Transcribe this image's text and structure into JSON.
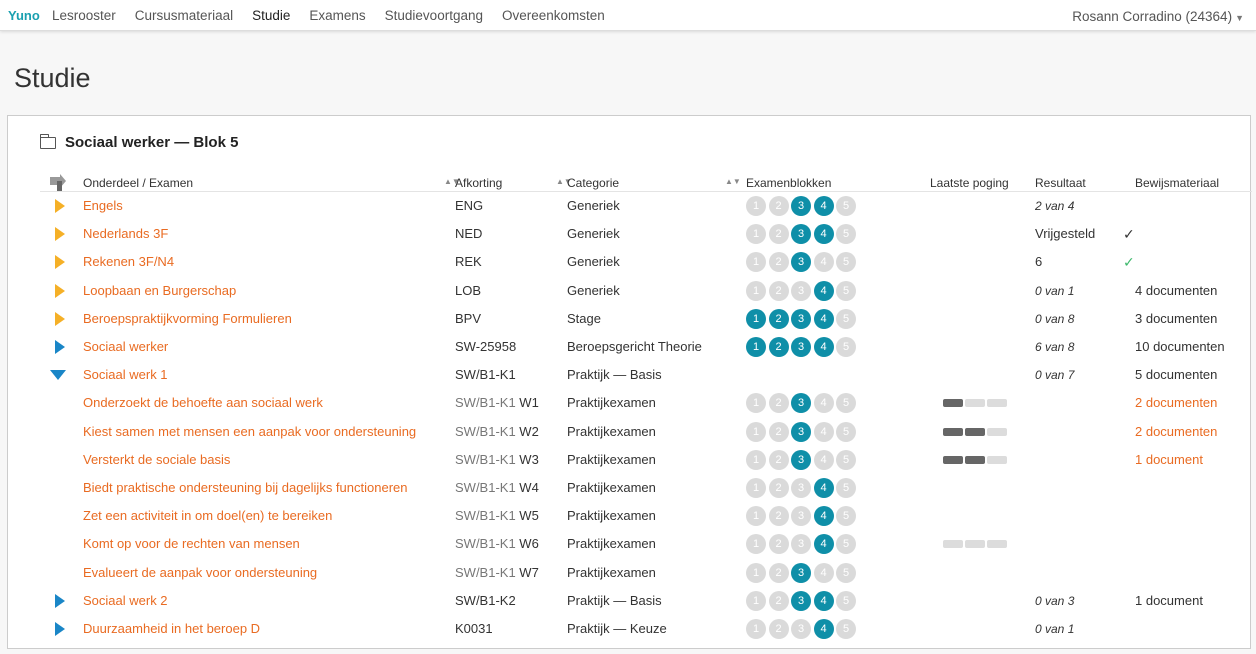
{
  "nav": {
    "brand": "Yuno",
    "items": [
      "Lesrooster",
      "Cursusmateriaal",
      "Studie",
      "Examens",
      "Studievoortgang",
      "Overeenkomsten"
    ],
    "active": "Studie",
    "user": "Rosann Corradino  (24364)"
  },
  "page": {
    "title": "Studie"
  },
  "card": {
    "title": "Sociaal werker — Blok 5"
  },
  "columns": {
    "name": "Onderdeel / Examen",
    "abbr": "Afkorting",
    "category": "Categorie",
    "blocks": "Examenblokken",
    "last_attempt": "Laatste poging",
    "result": "Resultaat",
    "evidence": "Bewijsmateriaal"
  },
  "rows": [
    {
      "name": "Engels",
      "abbr": "ENG",
      "category": "Generiek",
      "blocks": [
        3,
        4
      ],
      "result": "2 van 4",
      "result_italic": true,
      "evidence": "",
      "check": "",
      "toggle": "right-y"
    },
    {
      "name": "Nederlands 3F",
      "abbr": "NED",
      "category": "Generiek",
      "blocks": [
        3,
        4
      ],
      "result": "Vrijgesteld",
      "result_italic": false,
      "evidence": "",
      "check": "✓",
      "toggle": "right-y"
    },
    {
      "name": "Rekenen 3F/N4",
      "abbr": "REK",
      "category": "Generiek",
      "blocks": [
        3
      ],
      "result": "6",
      "result_italic": false,
      "evidence": "",
      "check": "✓",
      "check_green": true,
      "toggle": "right-y"
    },
    {
      "name": "Loopbaan en Burgerschap",
      "abbr": "LOB",
      "category": "Generiek",
      "blocks": [
        4
      ],
      "result": "0 van 1",
      "result_italic": true,
      "evidence": "4 documenten",
      "toggle": "right-y"
    },
    {
      "name": "Beroepspraktijkvorming Formulieren",
      "abbr": "BPV",
      "category": "Stage",
      "blocks": [
        1,
        2,
        3,
        4
      ],
      "result": "0 van 8",
      "result_italic": true,
      "evidence": "3 documenten",
      "toggle": "right-y"
    },
    {
      "name": "Sociaal werker",
      "abbr": "SW-25958",
      "category": "Beroepsgericht Theorie",
      "blocks": [
        1,
        2,
        3,
        4
      ],
      "result": "6 van 8",
      "result_italic": true,
      "evidence": "10 documenten",
      "toggle": "right-b"
    },
    {
      "name": "Sociaal werk 1",
      "abbr": "SW/B1-K1",
      "category": "Praktijk — Basis",
      "blocks": null,
      "result": "0 van 7",
      "result_italic": true,
      "evidence": "5 documenten",
      "toggle": "down-b"
    },
    {
      "name": "Onderzoekt de behoefte aan sociaal werk",
      "abbr": "SW/B1-K1 ",
      "abbr_w": "W1",
      "category": "Praktijkexamen",
      "blocks": [
        3
      ],
      "bars": 1,
      "evidence": "2 documenten",
      "evidence_link": true
    },
    {
      "name": "Kiest samen met mensen een aanpak voor ondersteuning",
      "abbr": "SW/B1-K1 ",
      "abbr_w": "W2",
      "category": "Praktijkexamen",
      "blocks": [
        3
      ],
      "bars": 2,
      "evidence": "2 documenten",
      "evidence_link": true
    },
    {
      "name": "Versterkt de sociale basis",
      "abbr": "SW/B1-K1 ",
      "abbr_w": "W3",
      "category": "Praktijkexamen",
      "blocks": [
        3
      ],
      "bars": 2,
      "evidence": "1 document",
      "evidence_link": true
    },
    {
      "name": "Biedt praktische ondersteuning bij dagelijks functioneren",
      "abbr": "SW/B1-K1 ",
      "abbr_w": "W4",
      "category": "Praktijkexamen",
      "blocks": [
        4
      ]
    },
    {
      "name": "Zet een activiteit in om doel(en) te bereiken",
      "abbr": "SW/B1-K1 ",
      "abbr_w": "W5",
      "category": "Praktijkexamen",
      "blocks": [
        4
      ]
    },
    {
      "name": "Komt op voor de rechten van mensen",
      "abbr": "SW/B1-K1 ",
      "abbr_w": "W6",
      "category": "Praktijkexamen",
      "blocks": [
        4
      ],
      "bars": 0
    },
    {
      "name": "Evalueert de aanpak voor ondersteuning",
      "abbr": "SW/B1-K1 ",
      "abbr_w": "W7",
      "category": "Praktijkexamen",
      "blocks": [
        3
      ]
    },
    {
      "name": "Sociaal werk 2",
      "abbr": "SW/B1-K2",
      "category": "Praktijk — Basis",
      "blocks": [
        3,
        4
      ],
      "result": "0 van 3",
      "result_italic": true,
      "evidence": "1 document",
      "toggle": "right-b"
    },
    {
      "name": "Duurzaamheid in het beroep D",
      "abbr": "K0031",
      "category": "Praktijk — Keuze",
      "blocks": [
        4
      ],
      "result": "0 van 1",
      "result_italic": true,
      "evidence": "",
      "toggle": "right-b"
    }
  ]
}
